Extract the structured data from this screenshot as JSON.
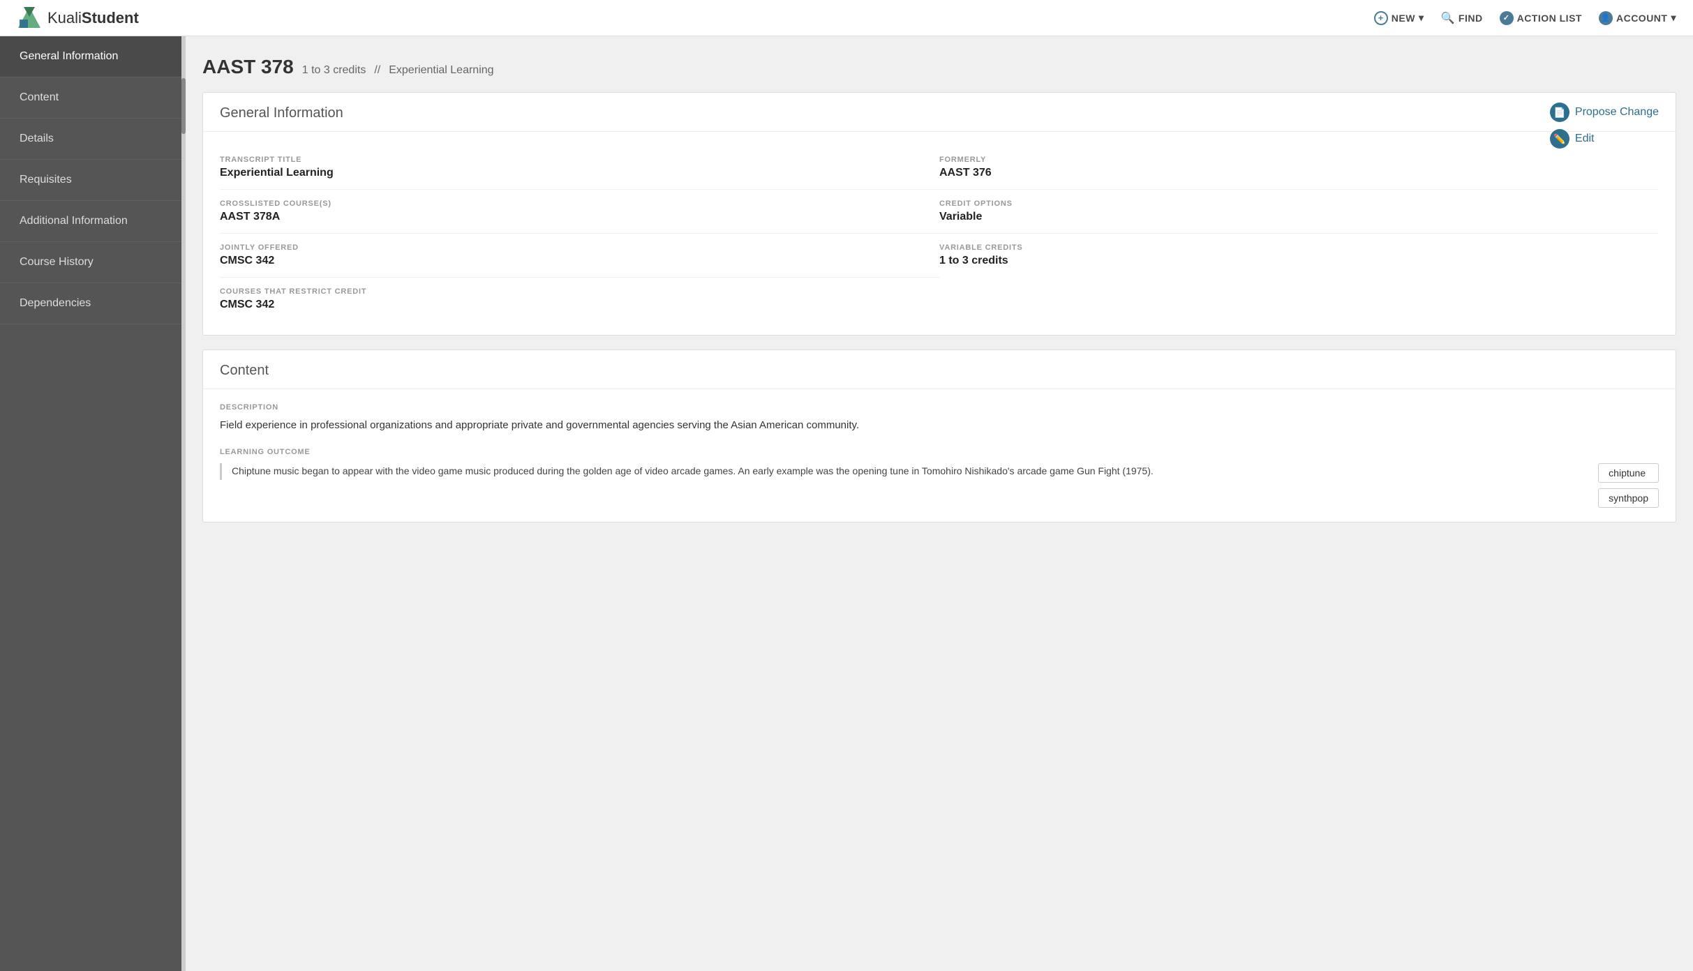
{
  "app": {
    "name_prefix": "Kuali",
    "name_bold": "Student"
  },
  "topnav": {
    "new_label": "NEW",
    "find_label": "FIND",
    "action_list_label": "ACTION LIST",
    "account_label": "ACCOUNT"
  },
  "sidebar": {
    "items": [
      {
        "id": "general-information",
        "label": "General Information",
        "active": true
      },
      {
        "id": "content",
        "label": "Content",
        "active": false
      },
      {
        "id": "details",
        "label": "Details",
        "active": false
      },
      {
        "id": "requisites",
        "label": "Requisites",
        "active": false
      },
      {
        "id": "additional-information",
        "label": "Additional Information",
        "active": false
      },
      {
        "id": "course-history",
        "label": "Course History",
        "active": false
      },
      {
        "id": "dependencies",
        "label": "Dependencies",
        "active": false
      }
    ]
  },
  "course": {
    "code": "AAST 378",
    "credits": "1 to 3 credits",
    "separator": "//",
    "type": "Experiential Learning"
  },
  "general_information": {
    "section_title": "General Information",
    "propose_change_label": "Propose Change",
    "edit_label": "Edit",
    "fields": [
      {
        "label": "TRANSCRIPT TITLE",
        "value": "Experiential Learning",
        "full": false
      },
      {
        "label": "FORMERLY",
        "value": "AAST 376",
        "full": false
      },
      {
        "label": "CROSSLISTED COURSE(S)",
        "value": "AAST 378A",
        "full": false
      },
      {
        "label": "CREDIT OPTIONS",
        "value": "Variable",
        "full": false
      },
      {
        "label": "JOINTLY OFFERED",
        "value": "CMSC 342",
        "full": false
      },
      {
        "label": "VARIABLE CREDITS",
        "value": "1 to 3 credits",
        "full": false
      },
      {
        "label": "COURSES THAT RESTRICT CREDIT",
        "value": "CMSC 342",
        "full": true
      }
    ]
  },
  "content": {
    "section_title": "Content",
    "description_label": "DESCRIPTION",
    "description_text": "Field experience in professional organizations and appropriate private and governmental agencies serving the Asian American community.",
    "learning_outcome_label": "LEARNING OUTCOME",
    "learning_outcome_text": "Chiptune music began to appear with the video game music produced during the golden age of video arcade games. An early example was the opening tune in Tomohiro Nishikado's arcade game Gun Fight (1975).",
    "tags": [
      "chiptune",
      "synthpop"
    ]
  }
}
